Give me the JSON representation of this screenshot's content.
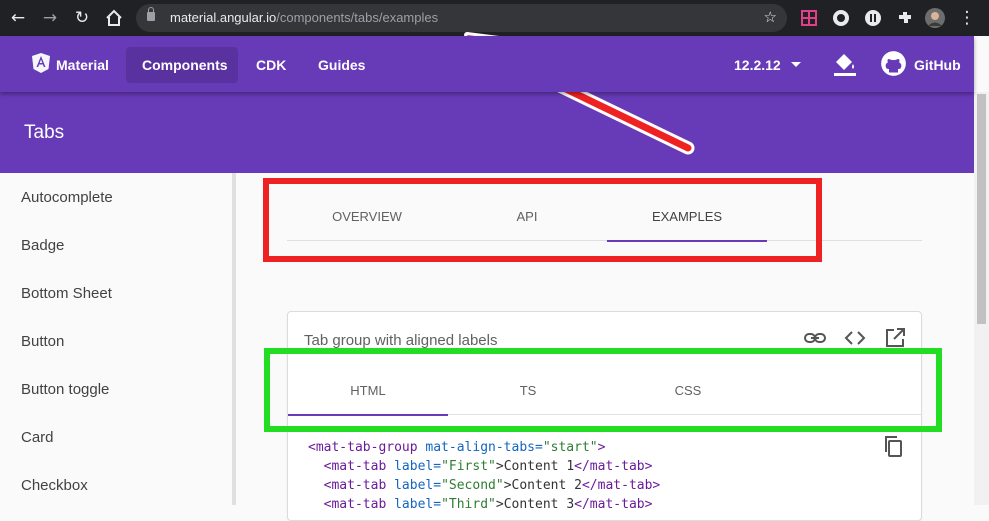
{
  "browser": {
    "url_host": "material.angular.io",
    "url_path": "/components/tabs/examples"
  },
  "toolbar": {
    "brand": "Material",
    "nav": [
      "Components",
      "CDK",
      "Guides"
    ],
    "version": "12.2.12",
    "github": "GitHub"
  },
  "header": {
    "title": "Tabs"
  },
  "sidebar": {
    "items": [
      "Autocomplete",
      "Badge",
      "Bottom Sheet",
      "Button",
      "Button toggle",
      "Card",
      "Checkbox"
    ]
  },
  "page_tabs": [
    "OVERVIEW",
    "API",
    "EXAMPLES"
  ],
  "example": {
    "title": "Tab group with aligned labels",
    "code_tabs": [
      "HTML",
      "TS",
      "CSS"
    ],
    "code": {
      "l1_open": "<mat-tab-group",
      "l1_attr": " mat-align-tabs=",
      "l1_str": "\"start\"",
      "l1_close": ">",
      "l2_open": "  <mat-tab",
      "l2_attr": " label=",
      "l2_str": "\"First\"",
      "l2_text": ">Content 1",
      "l2_close": "</mat-tab>",
      "l3_open": "  <mat-tab",
      "l3_attr": " label=",
      "l3_str": "\"Second\"",
      "l3_text": ">Content 2",
      "l3_close": "</mat-tab>",
      "l4_open": "  <mat-tab",
      "l4_attr": " label=",
      "l4_str": "\"Third\"",
      "l4_text": ">Content 3",
      "l4_close": "</mat-tab>"
    }
  },
  "colors": {
    "primary": "#673ab7",
    "annotation_red": "#ee2222",
    "annotation_green": "#22dd22"
  }
}
